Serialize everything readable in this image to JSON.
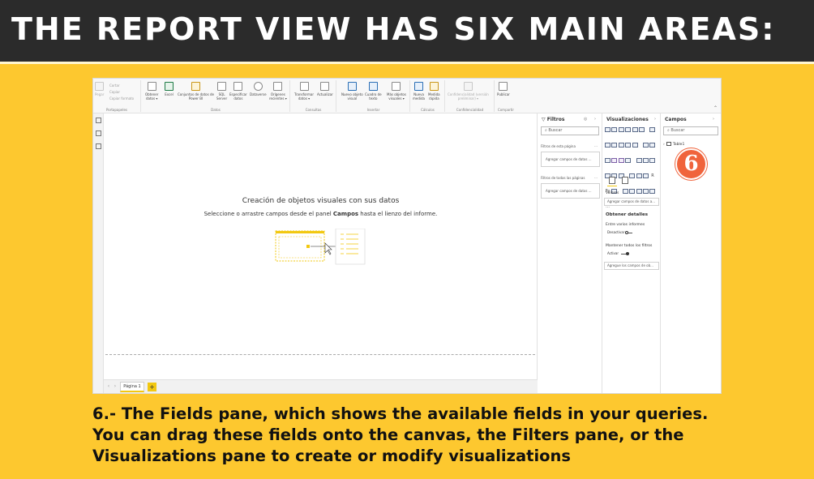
{
  "banner": {
    "title": "THE REPORT VIEW HAS SIX MAIN AREAS:"
  },
  "ribbon": {
    "clipboard": {
      "paste": "Pegar",
      "cut": "Cortar",
      "copy": "Copiar",
      "format": "Copiar formato",
      "group": "Portapapeles"
    },
    "data": {
      "group": "Datos",
      "buttons": [
        "Obtener\ndatos ▾",
        "Excel",
        "Conjuntos de datos de\nPower BI",
        "SQL\nServer",
        "Especificar\ndatos",
        "Dataverse",
        "Orígenes\nrecientes ▾"
      ]
    },
    "queries": {
      "group": "Consultas",
      "buttons": [
        "Transformar\ndatos ▾",
        "Actualizar"
      ]
    },
    "insert": {
      "group": "Insertar",
      "buttons": [
        "Nuevo objeto\nvisual",
        "Cuadro de\ntexto",
        "Más objetos\nvisuales ▾"
      ]
    },
    "calculations": {
      "group": "Cálculos",
      "buttons": [
        "Nueva\nmedida",
        "Medida\nrápida"
      ]
    },
    "sensitivity": {
      "group": "Confidencialidad",
      "button": "Confidencialidad (versión\npreliminar) ▾"
    },
    "share": {
      "group": "Compartir",
      "button": "Publicar"
    }
  },
  "canvas": {
    "placeholder_title": "Creación de objetos visuales con sus datos",
    "placeholder_pre": "Seleccione o arrastre campos desde el panel ",
    "placeholder_bold": "Campos",
    "placeholder_post": " hasta el lienzo del informe."
  },
  "page_tabs": {
    "page_label": "Página 1",
    "add_label": "+"
  },
  "filters_pane": {
    "title": "Filtros",
    "search_placeholder": "Buscar",
    "page_filters_label": "Filtros de esta página",
    "page_filters_well": "Agregar campos de datos ...",
    "all_filters_label": "Filtros de todas las páginas",
    "all_filters_well": "Agregar campos de datos ..."
  },
  "visualizations_pane": {
    "title": "Visualizaciones",
    "values_label": "Valores",
    "values_well": "Agregar campos de datos a...",
    "drill_heading": "Obtener detalles",
    "cross_report_label": "Entre varios informes",
    "cross_report_toggle": "Desactivar",
    "keep_filters_label": "Mantener todos los filtros",
    "keep_filters_toggle": "Activar",
    "drill_well": "Agregue los campos de ob..."
  },
  "fields_pane": {
    "title": "Campos",
    "search_placeholder": "Buscar",
    "table_name": "Table1"
  },
  "badge": {
    "number": "6"
  },
  "caption": {
    "text": "6.- The Fields pane, which shows the available fields in your queries. You can drag these fields onto the canvas, the Filters pane, or the Visualizations pane to create or modify visualizations"
  },
  "colors": {
    "banner": "#2b2b2b",
    "background": "#fdc82f",
    "badge": "#f0643c",
    "accent": "#f2c811"
  }
}
